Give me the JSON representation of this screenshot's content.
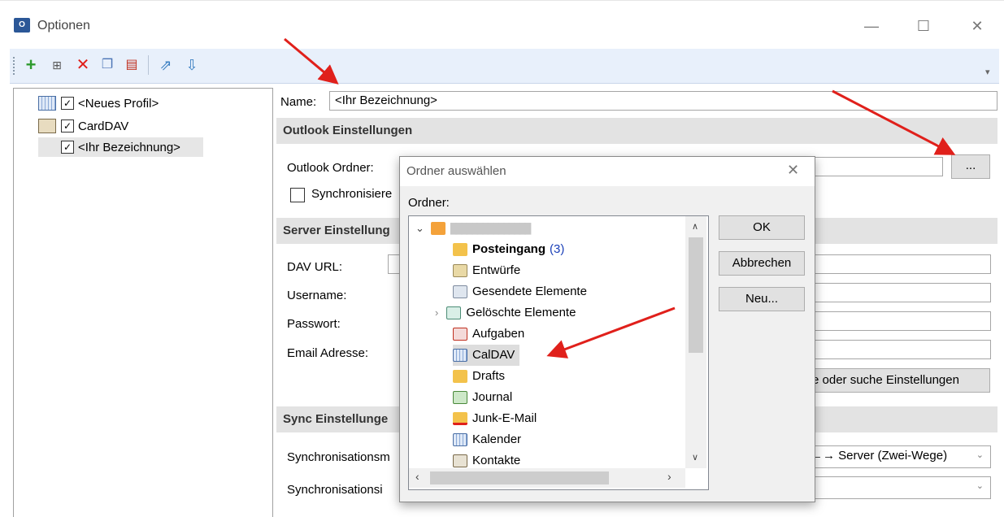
{
  "window": {
    "title": "Optionen",
    "app_icon_text": "O",
    "minimize_glyph": "—",
    "maximize_glyph": "☐",
    "close_glyph": "✕"
  },
  "toolbar": {
    "icons": [
      "add-icon",
      "copy-profile-icon",
      "delete-icon",
      "copy-icon",
      "clear-cache-icon",
      "export-icon",
      "import-icon"
    ],
    "overflow_glyph": "▾"
  },
  "tree": {
    "items": [
      {
        "label": "<Neues Profil>",
        "icon": "calendar-icon",
        "checked": true
      },
      {
        "label": "CardDAV",
        "icon": "contact-card-icon",
        "checked": true
      },
      {
        "label": "<Ihr Bezeichnung>",
        "icon": "",
        "checked": true
      }
    ]
  },
  "form": {
    "name_label": "Name:",
    "name_value": "<Ihr Bezeichnung>",
    "outlook_section": "Outlook Einstellungen",
    "outlook_folder_label": "Outlook Ordner:",
    "browse_button": "...",
    "sync_checkbox_label": "Synchronisiere",
    "server_section": "Server Einstellung",
    "dav_url_label": "DAV URL:",
    "username_label": "Username:",
    "password_label": "Passwort:",
    "email_label": "Email Adresse:",
    "test_button": "e oder suche Einstellungen",
    "sync_section": "Sync Einstellunge",
    "sync_mode_label": "Synchronisationsm",
    "sync_mode_value": "←→ Server (Zwei-Wege)",
    "sync_interval_label": "Synchronisationsi",
    "sync_interval_value": ""
  },
  "dialog": {
    "title": "Ordner auswählen",
    "close_glyph": "✕",
    "folder_label": "Ordner:",
    "ok_button": "OK",
    "cancel_button": "Abbrechen",
    "new_button": "Neu...",
    "root_account": "███████████████",
    "folders": [
      {
        "label": "Posteingang",
        "count": "(3)",
        "icon": "inbox-icon",
        "color": "#f3c24b",
        "bold": true
      },
      {
        "label": "Entwürfe",
        "count": "",
        "icon": "drafts-pencil-icon",
        "color": "#e9d9a6",
        "bold": false
      },
      {
        "label": "Gesendete Elemente",
        "count": "",
        "icon": "sent-items-icon",
        "color": "#dfe6ef",
        "bold": false
      },
      {
        "label": "Gelöschte Elemente",
        "count": "",
        "icon": "trash-icon",
        "color": "#d9efe7",
        "bold": false
      },
      {
        "label": "Aufgaben",
        "count": "",
        "icon": "tasks-icon",
        "color": "#f4dad9",
        "bold": false
      },
      {
        "label": "CalDAV",
        "count": "",
        "icon": "calendar-icon",
        "color": "#dfe9f7",
        "bold": false
      },
      {
        "label": "Drafts",
        "count": "",
        "icon": "folder-icon",
        "color": "#f3c24b",
        "bold": false
      },
      {
        "label": "Journal",
        "count": "",
        "icon": "journal-icon",
        "color": "#cde8c8",
        "bold": false
      },
      {
        "label": "Junk-E-Mail",
        "count": "",
        "icon": "junk-mail-icon",
        "color": "#f3c24b",
        "bold": false
      },
      {
        "label": "Kalender",
        "count": "",
        "icon": "calendar-icon",
        "color": "#dfe9f7",
        "bold": false
      },
      {
        "label": "Kontakte",
        "count": "",
        "icon": "contacts-icon",
        "color": "#e8e2d3",
        "bold": false
      }
    ],
    "selected_folder": "CalDAV"
  },
  "colors": {
    "accent_red": "#e0201b",
    "selection_bg": "#cce4f7",
    "count_blue": "#1a3fb8"
  }
}
